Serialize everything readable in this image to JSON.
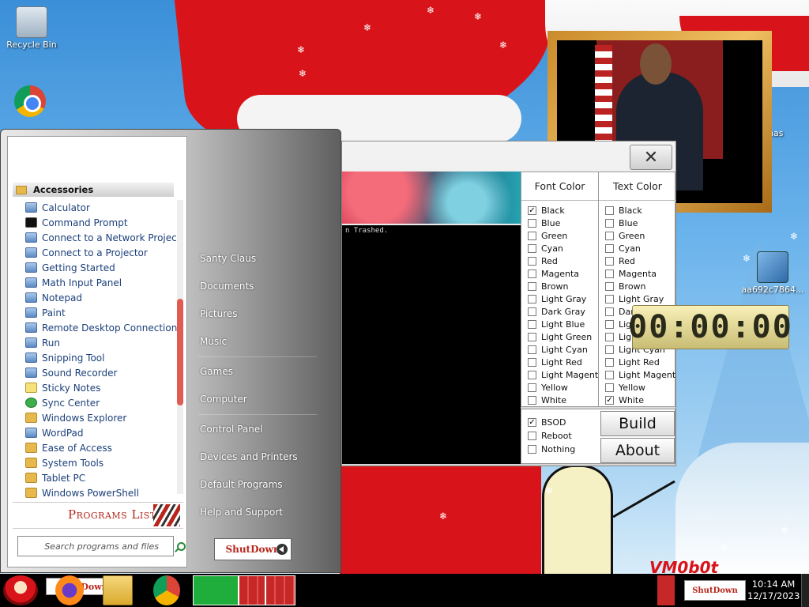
{
  "desktop": {
    "icons": [
      {
        "label": "Recycle Bin",
        "icon": "recycle-bin-icon"
      },
      {
        "label": "",
        "icon": "chrome-icon"
      },
      {
        "label": "aa692c7864...",
        "icon": "setup-installer-icon"
      }
    ],
    "partial_label": "tmas",
    "watermark": "VM0b0t"
  },
  "start_menu": {
    "category": "Accessories",
    "programs": [
      {
        "label": "Calculator",
        "folder": false
      },
      {
        "label": "Command Prompt",
        "folder": false
      },
      {
        "label": "Connect to a Network Projector",
        "folder": false
      },
      {
        "label": "Connect to a Projector",
        "folder": false
      },
      {
        "label": "Getting Started",
        "folder": false
      },
      {
        "label": "Math Input Panel",
        "folder": false
      },
      {
        "label": "Notepad",
        "folder": false
      },
      {
        "label": "Paint",
        "folder": false
      },
      {
        "label": "Remote Desktop Connection",
        "folder": false
      },
      {
        "label": "Run",
        "folder": false
      },
      {
        "label": "Snipping Tool",
        "folder": false
      },
      {
        "label": "Sound Recorder",
        "folder": false
      },
      {
        "label": "Sticky Notes",
        "folder": false
      },
      {
        "label": "Sync Center",
        "folder": false
      },
      {
        "label": "Windows Explorer",
        "folder": false
      },
      {
        "label": "WordPad",
        "folder": false
      },
      {
        "label": "Ease of Access",
        "folder": true
      },
      {
        "label": "System Tools",
        "folder": true
      },
      {
        "label": "Tablet PC",
        "folder": true
      },
      {
        "label": "Windows PowerShell",
        "folder": true
      }
    ],
    "programs_list_label": "Programs List",
    "search_placeholder": "Search programs and files",
    "right_items": [
      "Santy Claus",
      "Documents",
      "Pictures",
      "Music",
      "Games",
      "Computer",
      "Control Panel",
      "Devices and Printers",
      "Default Programs",
      "Help and Support"
    ],
    "shutdown_label": "ShutDown"
  },
  "builder": {
    "close_symbol": "✕",
    "console_text": "n Trashed.",
    "font_color_title": "Font Color",
    "text_color_title": "Text Color",
    "colors": [
      "Black",
      "Blue",
      "Green",
      "Cyan",
      "Red",
      "Magenta",
      "Brown",
      "Light Gray",
      "Dark Gray",
      "Light Blue",
      "Light Green",
      "Light Cyan",
      "Light Red",
      "Light Magenta",
      "Yellow",
      "White"
    ],
    "font_color_selected": "Black",
    "text_color_selected": "White",
    "actions": [
      {
        "label": "BSOD",
        "checked": true
      },
      {
        "label": "Reboot",
        "checked": false
      },
      {
        "label": "Nothing",
        "checked": false
      }
    ],
    "build_label": "Build",
    "about_label": "About"
  },
  "timer": {
    "value": "00:00:00"
  },
  "taskbar": {
    "shutdown_label": "ShutDown",
    "tray_label": "ShutDown",
    "time": "10:14 AM",
    "date": "12/17/2023"
  }
}
